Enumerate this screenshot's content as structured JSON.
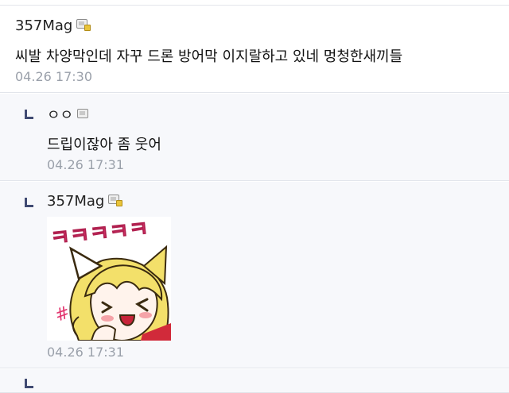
{
  "comments": [
    {
      "nick": "357Mag",
      "text": "씨발 차양막인데 자꾸 드론 방어막 이지랄하고 있네 멍청한새끼들",
      "date": "04.26 17:30"
    },
    {
      "nick": "ㅇㅇ",
      "text": "드립이잖아 좀 웃어",
      "date": "04.26 17:31"
    },
    {
      "nick": "357Mag",
      "sticker": "dccon-ㅋㅋㅋㅋㅋ",
      "sticker_text": "ㅋㅋㅋㅋㅋ",
      "date": "04.26 17:31"
    }
  ],
  "icons": {
    "gallog": "gallog-icon",
    "reply": "reply-arrow-icon"
  },
  "colors": {
    "reply_bg": "#f7f8fb",
    "date": "#9aa0aa",
    "reply_arrow": "#404a72",
    "sticker_text": "#e2366f"
  }
}
